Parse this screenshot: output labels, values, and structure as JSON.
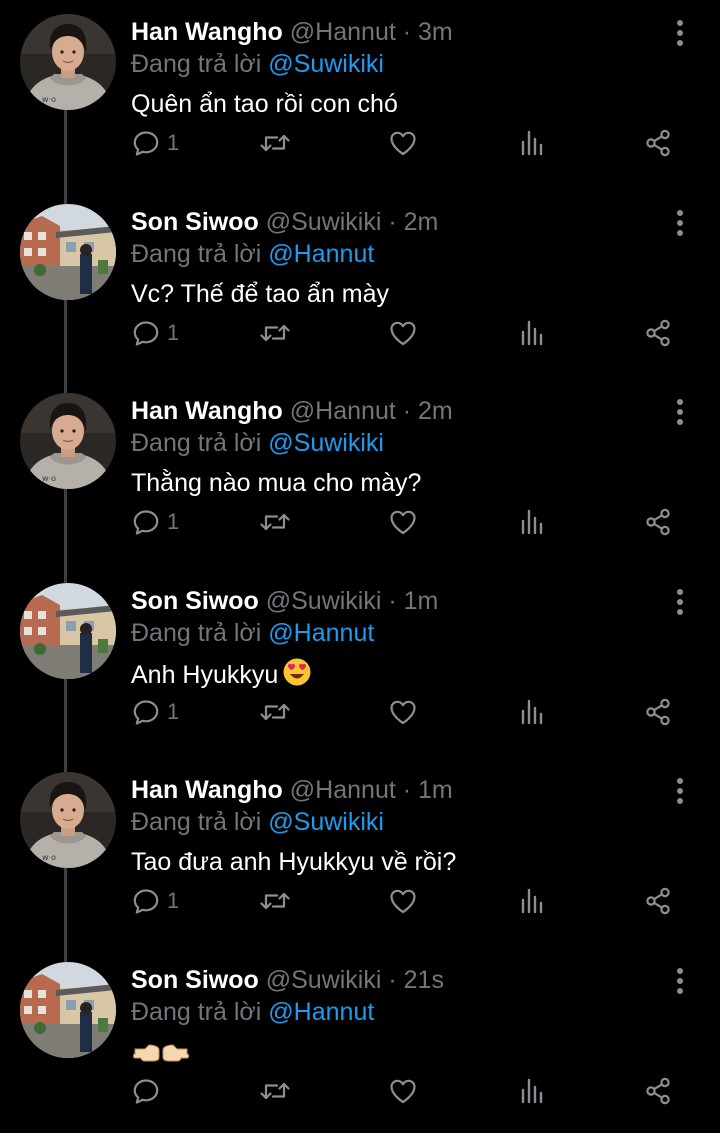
{
  "ui": {
    "reply_prefix": "Đang trả lời",
    "separator": "·",
    "colors": {
      "background": "#000000",
      "secondary": "#71767b",
      "accent": "#1d9bf0",
      "icon": "#8b8f94"
    },
    "icons": {
      "reply": "reply-icon",
      "retweet": "retweet-icon",
      "like": "heart-icon",
      "views": "analytics-icon",
      "share": "share-icon",
      "more": "more-vertical-icon"
    }
  },
  "tweets": [
    {
      "name": "Han Wangho",
      "handle": "@Hannut",
      "time": "3m",
      "reply_to": "@Suwikiki",
      "text": "Quên ẩn tao rồi con chó",
      "emoji": "",
      "reply_count": "1",
      "avatar": "person-hoodie"
    },
    {
      "name": "Son Siwoo",
      "handle": "@Suwikiki",
      "time": "2m",
      "reply_to": "@Hannut",
      "text": "Vc? Thế để tao ẩn mày",
      "emoji": "",
      "reply_count": "1",
      "avatar": "street-scene"
    },
    {
      "name": "Han Wangho",
      "handle": "@Hannut",
      "time": "2m",
      "reply_to": "@Suwikiki",
      "text": "Thằng nào mua cho mày?",
      "emoji": "",
      "reply_count": "1",
      "avatar": "person-hoodie"
    },
    {
      "name": "Son Siwoo",
      "handle": "@Suwikiki",
      "time": "1m",
      "reply_to": "@Hannut",
      "text": "Anh Hyukkyu",
      "emoji": "heart-eyes-emoji",
      "reply_count": "1",
      "avatar": "street-scene"
    },
    {
      "name": "Han Wangho",
      "handle": "@Hannut",
      "time": "1m",
      "reply_to": "@Suwikiki",
      "text": "Tao đưa anh Hyukkyu về rồi?",
      "emoji": "",
      "reply_count": "1",
      "avatar": "person-hoodie"
    },
    {
      "name": "Son Siwoo",
      "handle": "@Suwikiki",
      "time": "21s",
      "reply_to": "@Hannut",
      "text": "",
      "emoji": "pointing-hands-emoji",
      "reply_count": "",
      "avatar": "street-scene"
    }
  ]
}
